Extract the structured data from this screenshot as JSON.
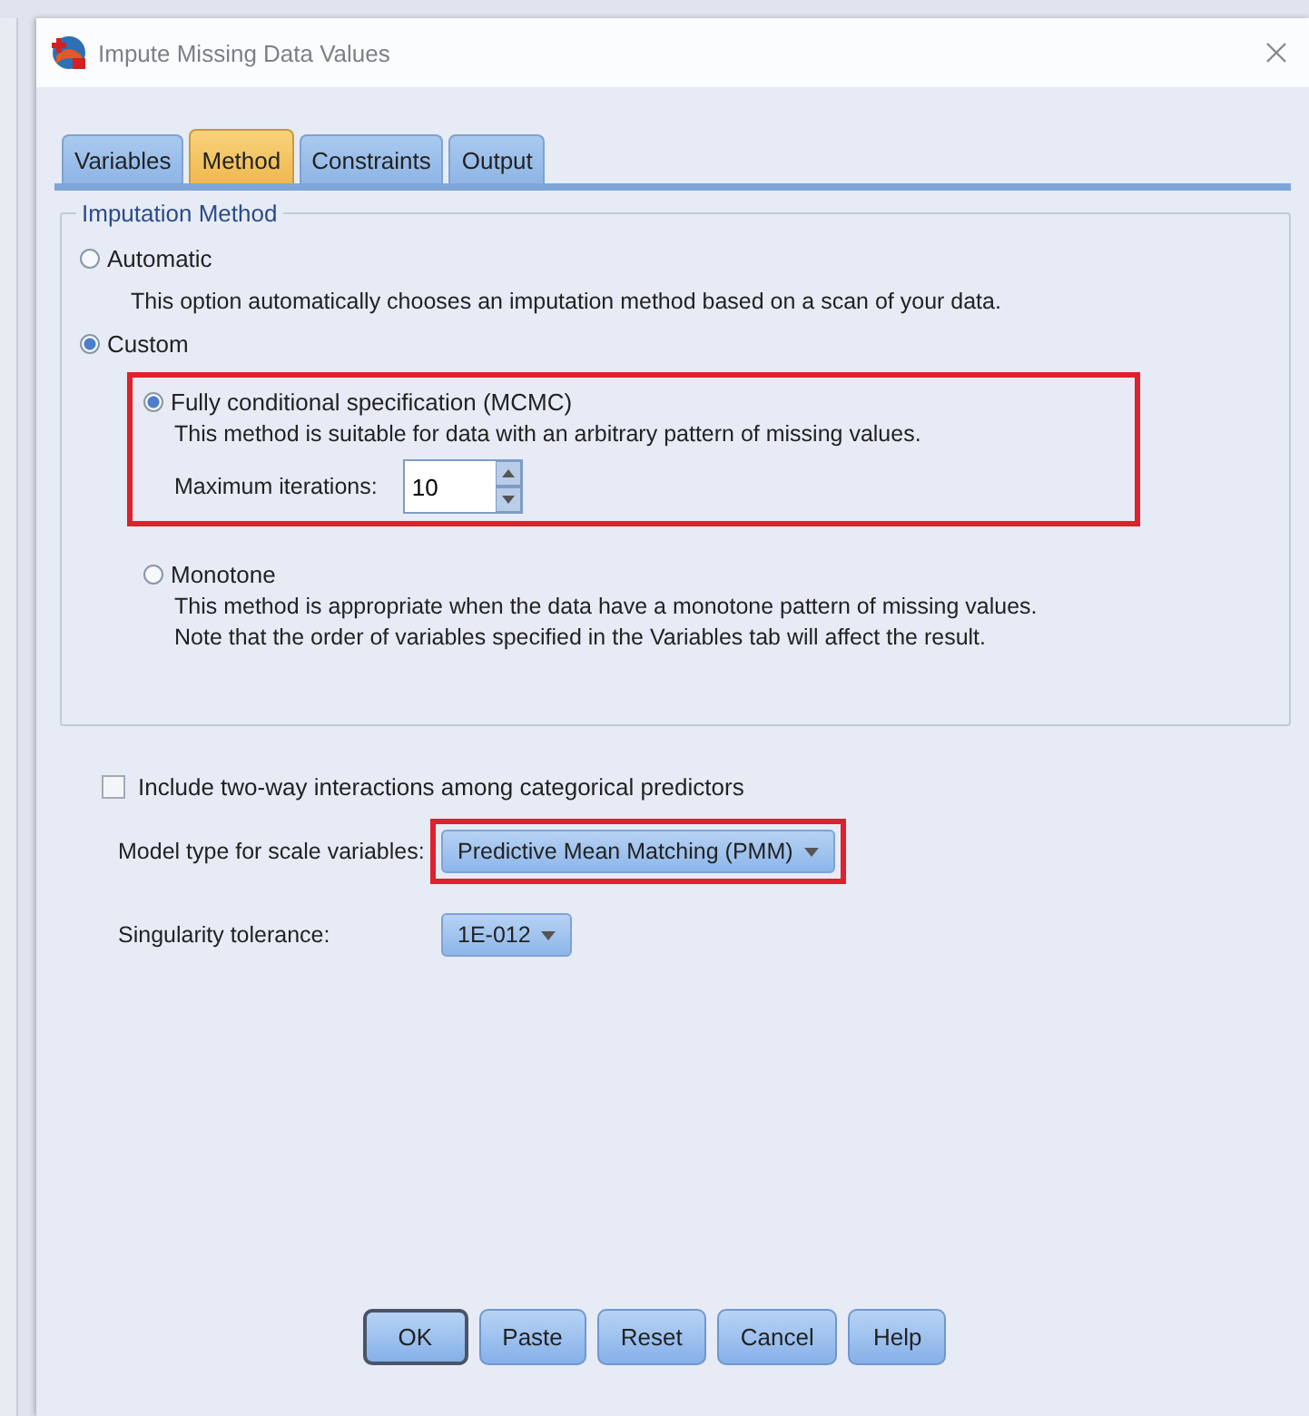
{
  "window": {
    "title": "Impute Missing Data Values"
  },
  "tabs": [
    {
      "label": "Variables",
      "selected": false
    },
    {
      "label": "Method",
      "selected": true
    },
    {
      "label": "Constraints",
      "selected": false
    },
    {
      "label": "Output",
      "selected": false
    }
  ],
  "imputation_method": {
    "title": "Imputation Method",
    "options": [
      {
        "label": "Automatic",
        "selected": false,
        "description": [
          "This option automatically chooses an imputation method based on a scan of your data."
        ]
      },
      {
        "label": "Custom",
        "selected": true,
        "suboptions": [
          {
            "label": "Fully conditional specification (MCMC)",
            "selected": true,
            "highlighted": true,
            "description": [
              "This method is suitable for data with an arbitrary pattern of missing values."
            ],
            "field": {
              "label": "Maximum iterations:",
              "value": "10"
            }
          },
          {
            "label": "Monotone",
            "selected": false,
            "highlighted": false,
            "description": [
              "This method is appropriate when the data have a monotone pattern of missing values.",
              "Note that the order of variables specified in the Variables tab will affect the result."
            ]
          }
        ]
      }
    ]
  },
  "interactions": {
    "label": "Include two-way interactions among categorical predictors",
    "checked": false
  },
  "dropdowns": [
    {
      "label": "Model type for scale variables:",
      "value": "Predictive Mean Matching (PMM)",
      "highlighted": true
    },
    {
      "label": "Singularity tolerance:",
      "value": "1E-012",
      "highlighted": false
    }
  ],
  "buttons": [
    {
      "label": "OK",
      "default": true
    },
    {
      "label": "Paste",
      "default": false
    },
    {
      "label": "Reset",
      "default": false
    },
    {
      "label": "Cancel",
      "default": false
    },
    {
      "label": "Help",
      "default": false
    }
  ]
}
